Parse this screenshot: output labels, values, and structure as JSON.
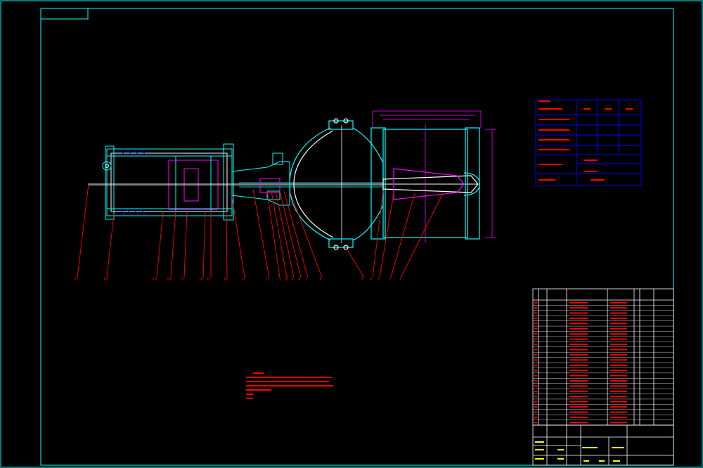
{
  "colors": {
    "background": "#000000",
    "frame": "#00ffff",
    "part_outline": "#ff00ff",
    "section_line": "#ffffff",
    "hatch": "#0000ff",
    "table_line": "#0000ff",
    "leader": "#ff0000",
    "text_red": "#ff0000",
    "dimension": "#ff00ff"
  },
  "balloons": [
    "20",
    "19",
    "18",
    "28",
    "17",
    "16",
    "15",
    "14",
    "13",
    "12",
    "11",
    "10",
    "9",
    "8",
    "7",
    "6",
    "5",
    "4",
    "3",
    "2",
    "1"
  ],
  "parts_table": {
    "header": [
      "序号",
      "代号",
      "名称",
      "数量",
      "材料",
      "重量",
      "备注"
    ],
    "row_count": 24
  },
  "tech_table_rows": 7
}
